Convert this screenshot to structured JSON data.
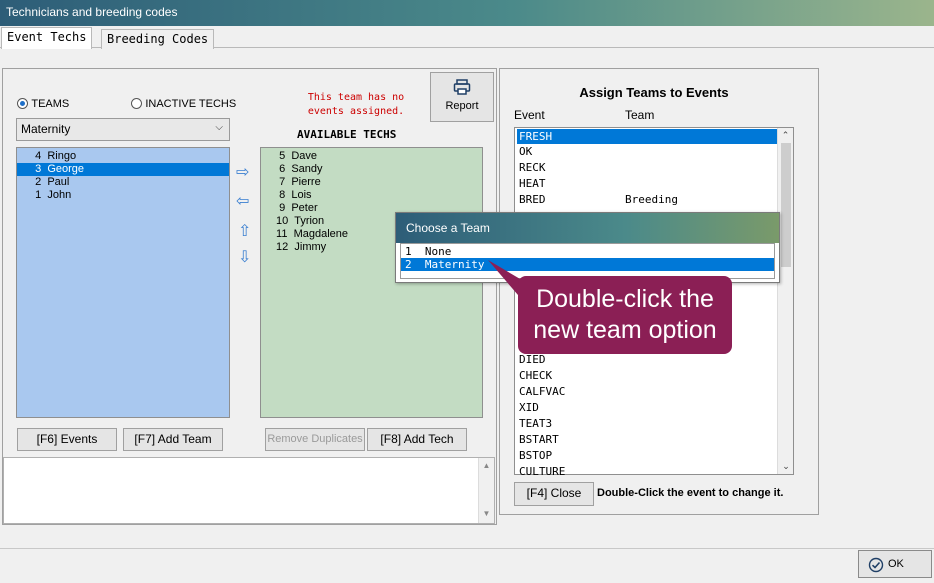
{
  "window": {
    "title": "Technicians and breeding codes"
  },
  "tabs": [
    {
      "label": "Event Techs"
    },
    {
      "label": "Breeding Codes"
    }
  ],
  "left": {
    "radio_teams": "TEAMS",
    "radio_inactive": "INACTIVE TECHS",
    "team_select_value": "Maternity",
    "team_members": [
      {
        "text": "  4  Ringo"
      },
      {
        "text": "  3  George"
      },
      {
        "text": "  2  Paul"
      },
      {
        "text": "  1  John"
      }
    ],
    "message_line1": "This team has no",
    "message_line2": "events assigned.",
    "report_label": "Report",
    "available_heading": "AVAILABLE TECHS",
    "available_techs": [
      {
        "text": "  5  Dave"
      },
      {
        "text": "  6  Sandy"
      },
      {
        "text": "  7  Pierre"
      },
      {
        "text": "  8  Lois"
      },
      {
        "text": "  9  Peter"
      },
      {
        "text": " 10  Tyrion"
      },
      {
        "text": " 11  Magdalene"
      },
      {
        "text": " 12  Jimmy"
      }
    ],
    "buttons": {
      "events": "[F6] Events",
      "add_team": "[F7] Add Team",
      "remove_duplicates": "Remove Duplicates",
      "add_tech": "[F8] Add Tech"
    }
  },
  "right": {
    "heading": "Assign Teams to Events",
    "col_event": "Event",
    "col_team": "Team",
    "events_top": [
      {
        "text": "FRESH"
      },
      {
        "text": "OK"
      },
      {
        "text": "RECK"
      },
      {
        "text": "HEAT"
      },
      {
        "text": "BRED            Breeding"
      }
    ],
    "events_bottom": [
      {
        "text": "DIED"
      },
      {
        "text": "CHECK"
      },
      {
        "text": "CALFVAC"
      },
      {
        "text": "XID"
      },
      {
        "text": "TEAT3"
      },
      {
        "text": "BSTART"
      },
      {
        "text": "BSTOP"
      },
      {
        "text": "CULTURE"
      }
    ],
    "close_label": "[F4] Close",
    "hint": "Double-Click the event to change it."
  },
  "popup": {
    "title": "Choose a Team",
    "options": [
      {
        "text": "1  None"
      },
      {
        "text": "2  Maternity"
      }
    ]
  },
  "callout": {
    "line1": "Double-click the",
    "line2": "new team option"
  },
  "footer": {
    "ok_label": "OK"
  },
  "colors": {
    "selection": "#0078d7",
    "callout": "#8b1f55",
    "teams_list": "#a9c8ef",
    "available_list": "#c3dcc3"
  }
}
